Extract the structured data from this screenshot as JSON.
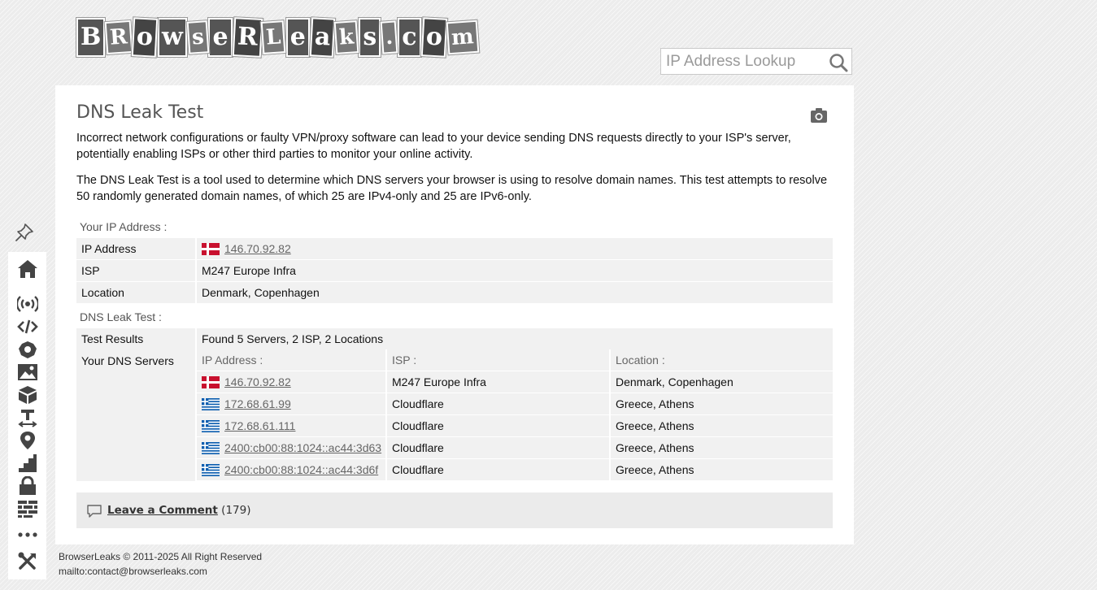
{
  "logo": {
    "letters": [
      "B",
      "R",
      "o",
      "w",
      "s",
      "e",
      "R",
      "L",
      "e",
      "a",
      "k",
      "s",
      ".",
      "c",
      "o",
      "m"
    ],
    "text": "BrowserLeaks.com"
  },
  "search": {
    "placeholder": "IP Address Lookup",
    "value": ""
  },
  "page": {
    "title": "DNS Leak Test",
    "para1": "Incorrect network configurations or faulty VPN/proxy software can lead to your device sending DNS requests directly to your ISP's server, potentially enabling ISPs or other third parties to monitor your online activity.",
    "para2": "The DNS Leak Test is a tool used to determine which DNS servers your browser is using to resolve domain names. This test attempts to resolve 50 randomly generated domain names, of which 25 are IPv4-only and 25 are IPv6-only."
  },
  "ip_section": {
    "heading": "Your IP Address :",
    "rows": [
      {
        "label": "IP Address",
        "value": "146.70.92.82",
        "flag": "denmark"
      },
      {
        "label": "ISP",
        "value": "M247 Europe Infra"
      },
      {
        "label": "Location",
        "value": "Denmark, Copenhagen"
      }
    ]
  },
  "dns_section": {
    "heading": "DNS Leak Test :",
    "results_label": "Test Results",
    "results_value": "Found 5 Servers, 2 ISP, 2 Locations",
    "servers_label": "Your DNS Servers",
    "columns": [
      "IP Address :",
      "ISP :",
      "Location :"
    ],
    "servers": [
      {
        "ip": "146.70.92.82",
        "flag": "denmark",
        "isp": "M247 Europe Infra",
        "location": "Denmark, Copenhagen"
      },
      {
        "ip": "172.68.61.99",
        "flag": "greece",
        "isp": "Cloudflare",
        "location": "Greece, Athens"
      },
      {
        "ip": "172.68.61.111",
        "flag": "greece",
        "isp": "Cloudflare",
        "location": "Greece, Athens"
      },
      {
        "ip": "2400:cb00:88:1024::ac44:3d63",
        "flag": "greece",
        "isp": "Cloudflare",
        "location": "Greece, Athens"
      },
      {
        "ip": "2400:cb00:88:1024::ac44:3d6f",
        "flag": "greece",
        "isp": "Cloudflare",
        "location": "Greece, Athens"
      }
    ]
  },
  "comment": {
    "link": "Leave a Comment",
    "count": "(179)"
  },
  "sidebar": {
    "icons": [
      "pin-icon",
      "home-icon",
      "broadcast-icon",
      "code-icon",
      "webgl-icon",
      "image-icon",
      "box-icon",
      "text-size-icon",
      "location-icon",
      "stairs-icon",
      "lock-icon",
      "wall-icon",
      "more-icon",
      "tools-icon"
    ]
  },
  "footer": {
    "copyright": "BrowserLeaks © 2011-2025 All Right Reserved",
    "contact": "mailto:contact@browserleaks.com"
  },
  "colors": {
    "flag_denmark": "#c8102e",
    "flag_greece": "#0d5eaf",
    "link": "#666666"
  }
}
